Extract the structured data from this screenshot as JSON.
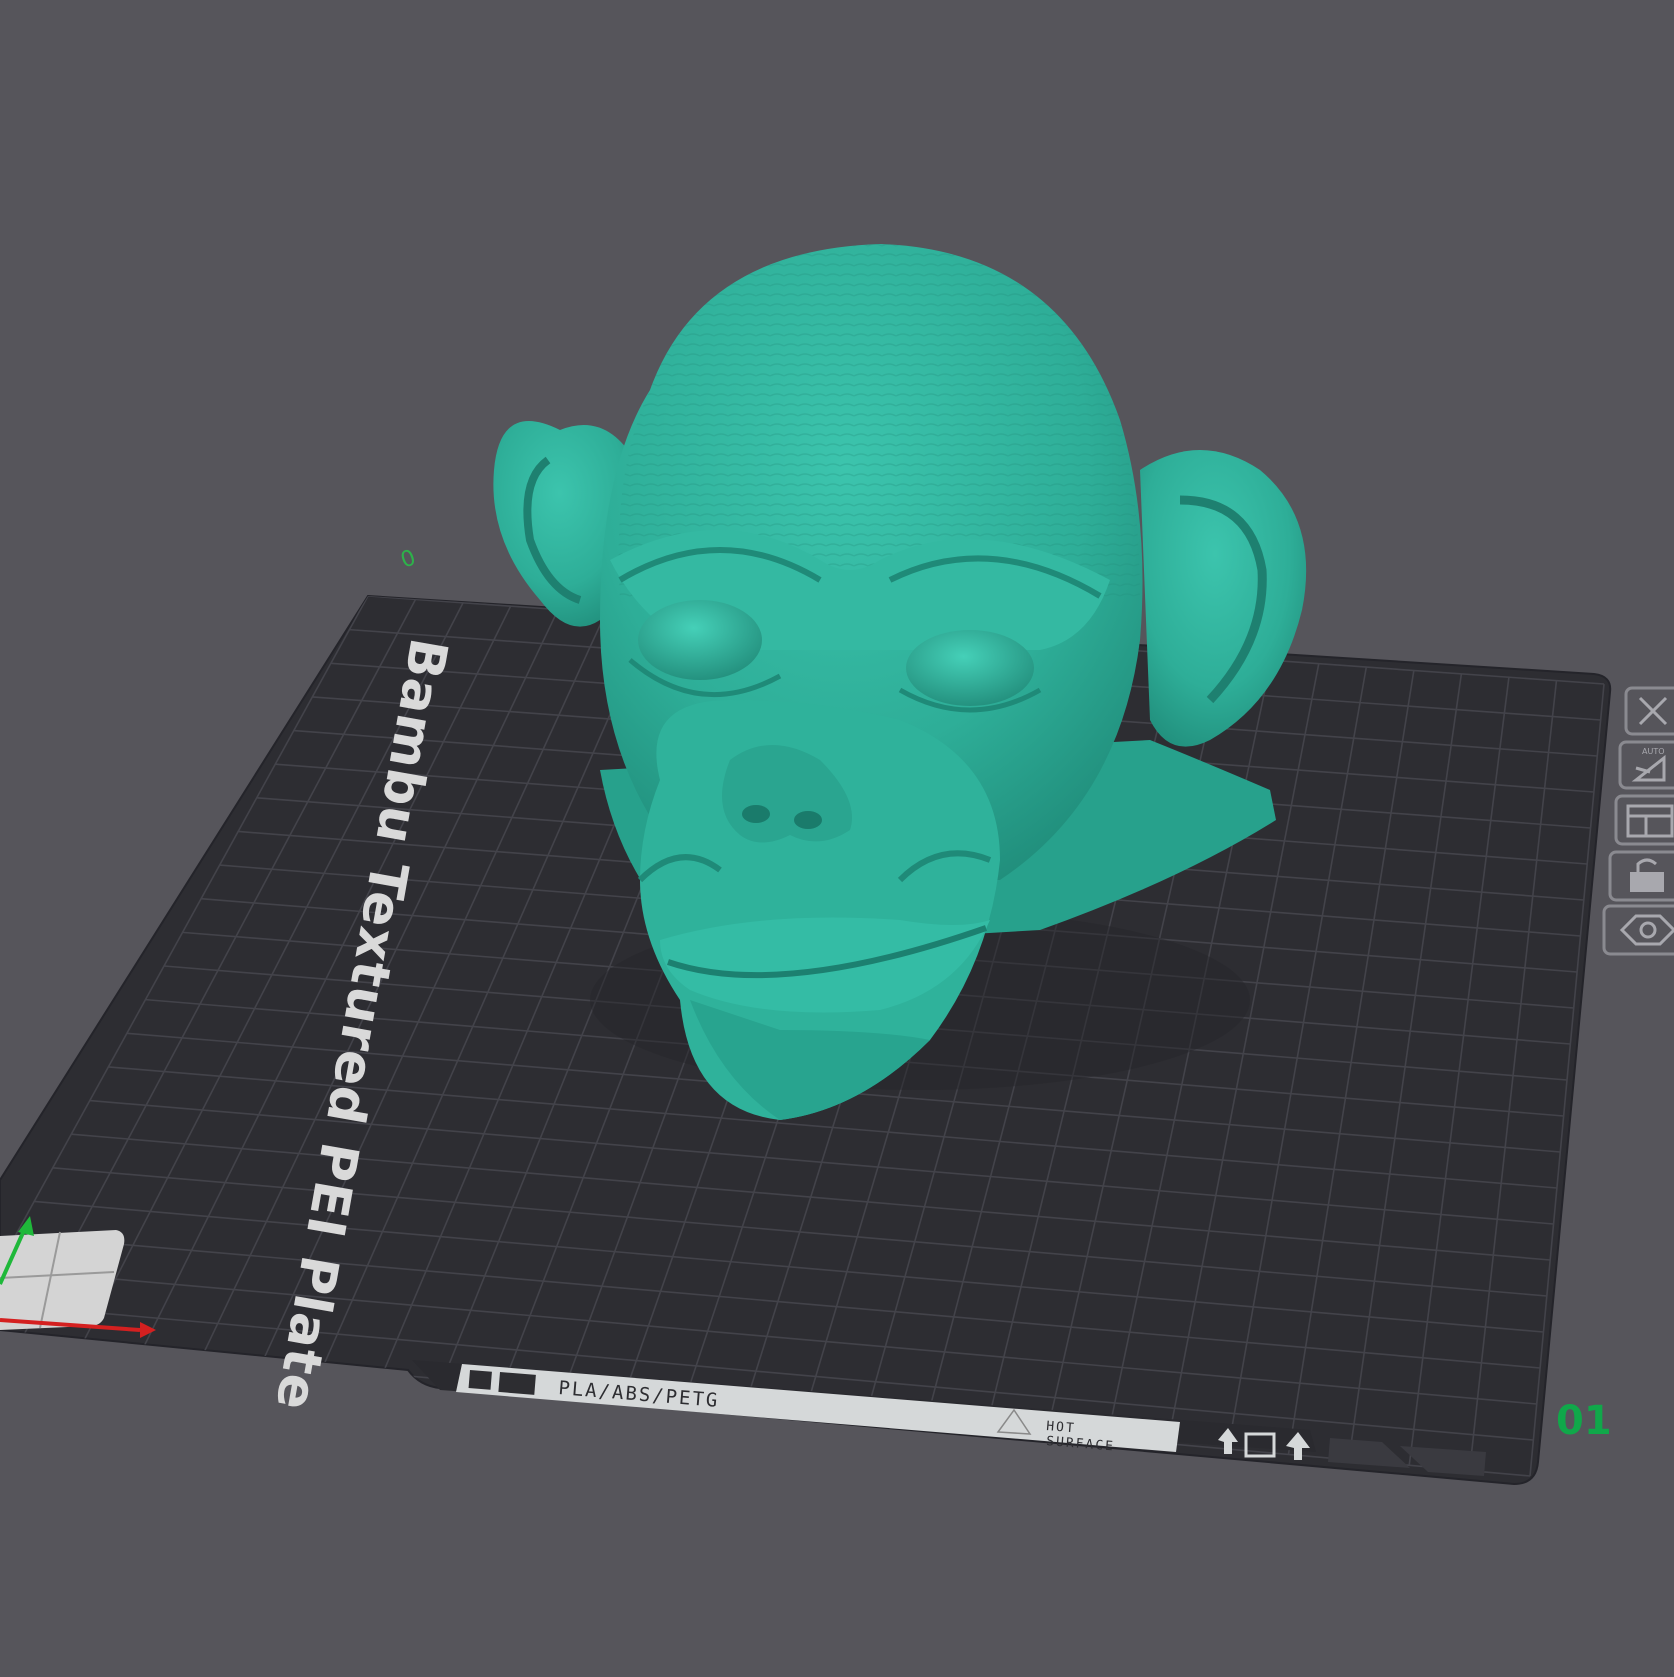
{
  "viewport": {
    "background_color": "#56555b",
    "model_color": "#2eae98"
  },
  "plate": {
    "name": "Bambu Textured PEI Plate",
    "number": "01",
    "origin_label": "0",
    "material_label": "PLA/ABS/PETG",
    "warning_line1": "HOT",
    "warning_line2": "SURFACE",
    "grid_color": "#3a3a40",
    "plate_color": "#2d2d32"
  },
  "plate_toolbar": {
    "items": [
      {
        "icon": "close-icon",
        "label": "Remove plate"
      },
      {
        "icon": "auto-orient-icon",
        "label": "Auto orient",
        "badge": "AUTO"
      },
      {
        "icon": "arrange-icon",
        "label": "Arrange"
      },
      {
        "icon": "lock-icon",
        "label": "Lock plate"
      },
      {
        "icon": "plate-settings-icon",
        "label": "Plate settings"
      }
    ]
  },
  "axes": {
    "x_color": "#d42020",
    "y_color": "#1fb83a"
  }
}
